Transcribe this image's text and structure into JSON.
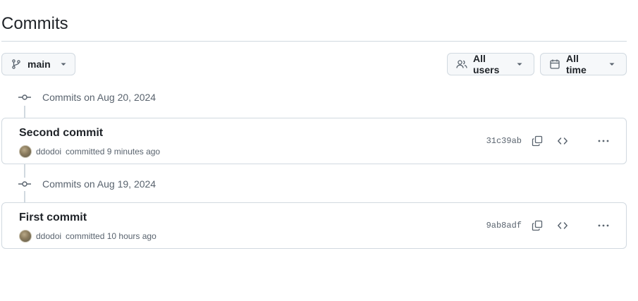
{
  "page": {
    "title": "Commits"
  },
  "toolbar": {
    "branch_label": "main",
    "users_label": "All users",
    "time_label": "All time"
  },
  "groups": [
    {
      "date_label": "Commits on Aug 20, 2024",
      "commit": {
        "title": "Second commit",
        "author": "ddodoi",
        "meta_text": "committed 9 minutes ago",
        "sha": "31c39ab"
      }
    },
    {
      "date_label": "Commits on Aug 19, 2024",
      "commit": {
        "title": "First commit",
        "author": "ddodoi",
        "meta_text": "committed 10 hours ago",
        "sha": "9ab8adf"
      }
    }
  ],
  "icons": {
    "branch": "git-branch-icon",
    "users": "people-icon",
    "time": "calendar-icon",
    "commit_node": "git-commit-icon",
    "copy": "copy-icon",
    "browse": "code-icon",
    "more": "kebab-horizontal-icon",
    "caret": "triangle-down-icon"
  },
  "colors": {
    "border": "#d1d9e0",
    "muted_text": "#59636e",
    "button_bg": "#f6f8fa",
    "text": "#1f2328"
  }
}
